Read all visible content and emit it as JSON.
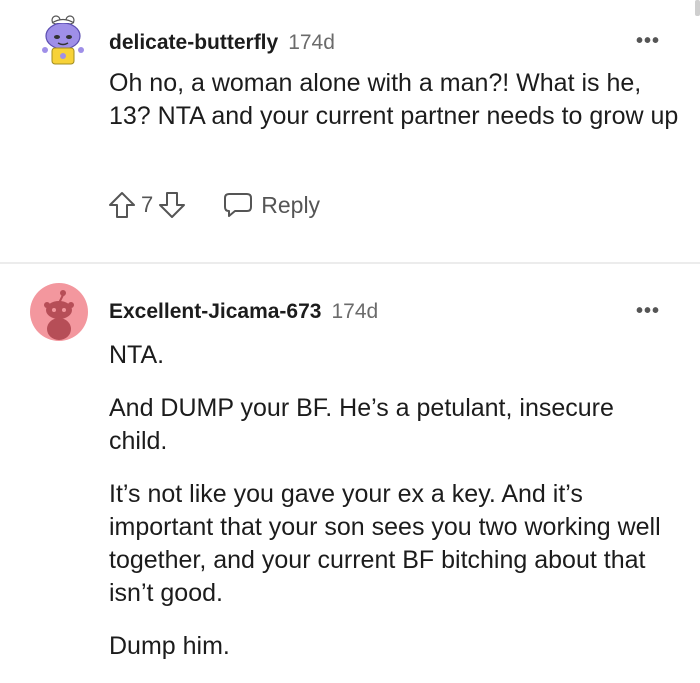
{
  "comments": [
    {
      "username": "delicate-butterfly",
      "age": "174d",
      "more": "•••",
      "paragraphs": [
        "Oh no, a woman alone with a man?! What is he, 13? NTA and your current partner needs to grow up"
      ],
      "score": "7",
      "reply_label": "Reply",
      "avatar_colors": {
        "face": "#9f8fe8",
        "shirt": "#f7d238"
      }
    },
    {
      "username": "Excellent-Jicama-673",
      "age": "174d",
      "more": "•••",
      "paragraphs": [
        "NTA.",
        "And DUMP your BF. He’s a petulant, insecure child.",
        "It’s not like you gave your ex a key. And it’s important that your son sees you two working well together, and your current BF bitching about that isn’t good.",
        "Dump him."
      ],
      "avatar_colors": {
        "bg": "#f3979e",
        "figure": "#b64e57"
      }
    }
  ],
  "colors": {
    "divider": "#ececec",
    "muted": "#6b6b6b"
  }
}
